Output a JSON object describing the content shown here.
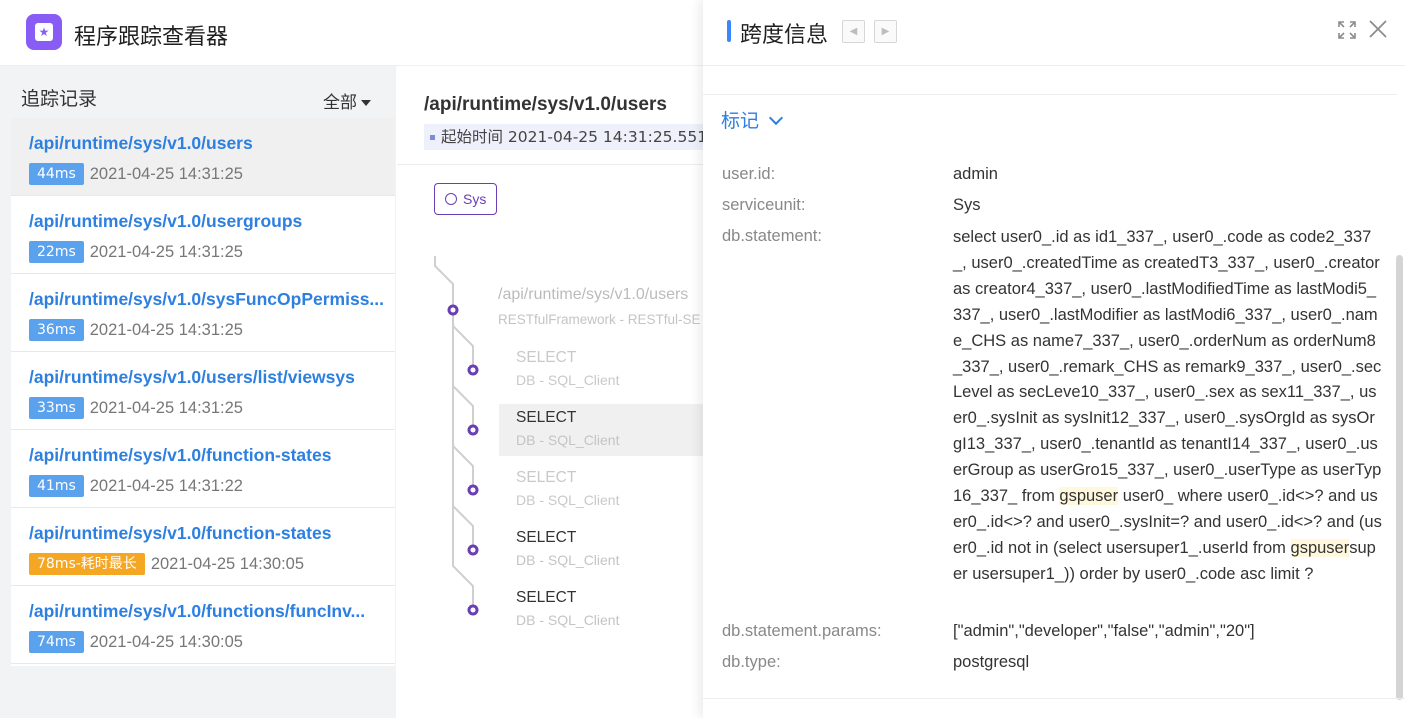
{
  "app": {
    "title": "程序跟踪查看器"
  },
  "list": {
    "title": "追踪记录",
    "filter": "全部",
    "items": [
      {
        "path": "/api/runtime/sys/v1.0/users",
        "duration": "44ms",
        "time": "2021-04-25 14:31:25",
        "selected": true
      },
      {
        "path": "/api/runtime/sys/v1.0/usergroups",
        "duration": "22ms",
        "time": "2021-04-25 14:31:25"
      },
      {
        "path": "/api/runtime/sys/v1.0/sysFuncOpPermiss...",
        "duration": "36ms",
        "time": "2021-04-25 14:31:25"
      },
      {
        "path": "/api/runtime/sys/v1.0/users/list/viewsys",
        "duration": "33ms",
        "time": "2021-04-25 14:31:25"
      },
      {
        "path": "/api/runtime/sys/v1.0/function-states",
        "duration": "41ms",
        "time": "2021-04-25 14:31:22"
      },
      {
        "path": "/api/runtime/sys/v1.0/function-states",
        "duration": "78ms-耗时最长",
        "time": "2021-04-25 14:30:05",
        "warn": true
      },
      {
        "path": "/api/runtime/sys/v1.0/functions/funcInv...",
        "duration": "74ms",
        "time": "2021-04-25 14:30:05"
      }
    ]
  },
  "trace": {
    "title": "/api/runtime/sys/v1.0/users",
    "start": "起始时间 2021-04-25 14:31:25.551",
    "service_tag": "Sys",
    "root": {
      "name": "/api/runtime/sys/v1.0/users",
      "sub": "RESTfulFramework - RESTful-SE"
    },
    "spans": [
      {
        "name": "SELECT",
        "sub": "DB - SQL_Client"
      },
      {
        "name": "SELECT",
        "sub": "DB - SQL_Client"
      },
      {
        "name": "SELECT",
        "sub": "DB - SQL_Client"
      },
      {
        "name": "SELECT",
        "sub": "DB - SQL_Client"
      },
      {
        "name": "SELECT",
        "sub": "DB - SQL_Client"
      }
    ]
  },
  "drawer": {
    "title": "跨度信息",
    "section": "标记",
    "fields": {
      "user_id_key": "user.id:",
      "user_id_val": "admin",
      "serviceunit_key": "serviceunit:",
      "serviceunit_val": "Sys",
      "statement_key": "db.statement:",
      "statement_part1": "select user0_.id as id1_337_, user0_.code as code2_337_, user0_.createdTime as createdT3_337_, user0_.creator as creator4_337_, user0_.lastModifiedTime as lastModi5_337_, user0_.lastModifier as lastModi6_337_, user0_.name_CHS as name7_337_, user0_.orderNum as orderNum8_337_, user0_.remark_CHS as remark9_337_, user0_.secLevel as secLeve10_337_, user0_.sex as sex11_337_, user0_.sysInit as sysInit12_337_, user0_.sysOrgId as sysOrgI13_337_, user0_.tenantId as tenantI14_337_, user0_.userGroup as userGro15_337_, user0_.userType as userTyp16_337_ from ",
      "statement_hl1": "gspuser",
      "statement_part2": " user0_ where user0_.id<>? and user0_.id<>? and user0_.sysInit=? and user0_.id<>? and (user0_.id not in  (select usersuper1_.userId from ",
      "statement_hl2": "gspuser",
      "statement_part3": "super usersuper1_)) order by user0_.code asc limit ?",
      "params_key": "db.statement.params:",
      "params_val": "[\"admin\",\"developer\",\"false\",\"admin\",\"20\"]",
      "dbtype_key": "db.type:",
      "dbtype_val": "postgresql"
    }
  },
  "icons": {
    "logo": "bookmark-star-icon",
    "expand": "fullscreen-icon",
    "close": "close-icon",
    "prev": "caret-left-icon",
    "next": "caret-right-icon"
  },
  "colors": {
    "accent": "#2d7fe0",
    "brand": "#8a5cf6",
    "badge": "#5aa2ee",
    "warn": "#f5a623",
    "tree": "#6a3fb5"
  }
}
